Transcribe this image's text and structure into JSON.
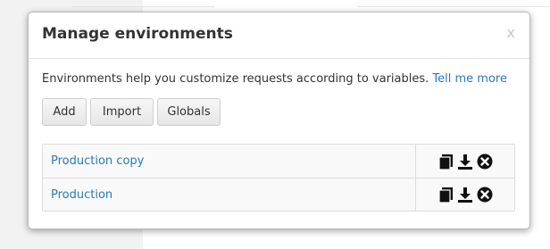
{
  "modal": {
    "title": "Manage environments",
    "close_label": "x",
    "intro_text": "Environments help you customize requests according to variables.",
    "intro_link": "Tell me more"
  },
  "buttons": {
    "add": "Add",
    "import": "Import",
    "globals": "Globals"
  },
  "environments": [
    {
      "name": "Production copy",
      "icons": [
        "duplicate-icon",
        "download-icon",
        "delete-icon"
      ]
    },
    {
      "name": "Production",
      "icons": [
        "duplicate-icon",
        "download-icon",
        "delete-icon"
      ]
    }
  ],
  "colors": {
    "link": "#2a7ab8",
    "title": "#333333",
    "close": "#c6c6c6"
  }
}
